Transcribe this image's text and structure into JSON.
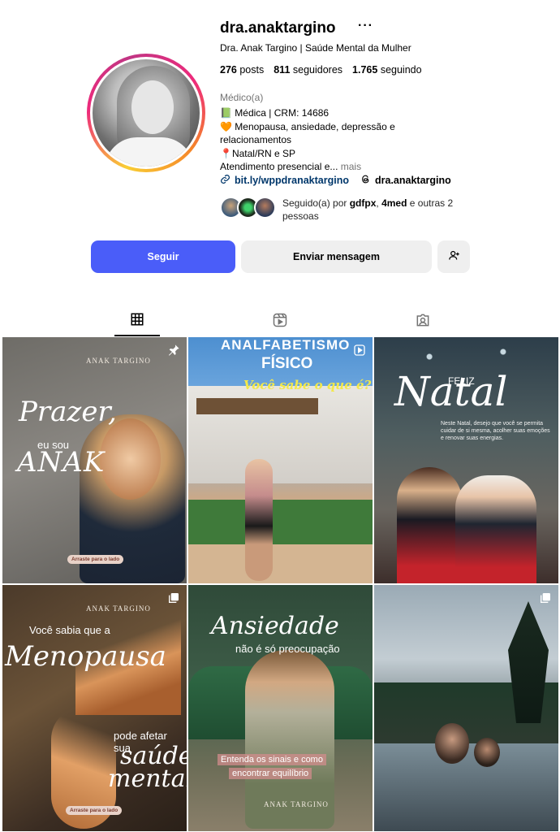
{
  "profile": {
    "username": "dra.anaktargino",
    "more_label": "···",
    "full_name": "Dra. Anak Targino | Saúde Mental da Mulher",
    "stats": {
      "posts_count": "276",
      "posts_label": "posts",
      "followers_count": "811",
      "followers_label": "seguidores",
      "following_count": "1.765",
      "following_label": "seguindo"
    },
    "category": "Médico(a)",
    "bio": {
      "line1": "📗 Médica | CRM: 14686",
      "line2": "🧡 Menopausa, ansiedade, depressão e relacionamentos",
      "line3": "📍Natal/RN e SP",
      "line4": "Atendimento presencial e...",
      "more": " mais"
    },
    "link": "bit.ly/wppdranaktargino",
    "threads": "dra.anaktargino",
    "followed_by": {
      "prefix": "Seguido(a) por ",
      "user1": "gdfpx",
      "sep": ", ",
      "user2": "4med",
      "suffix": " e outras 2 pessoas"
    }
  },
  "actions": {
    "follow": "Seguir",
    "message": "Enviar mensagem"
  },
  "icons": {
    "more": "more-dots-icon",
    "link": "link-icon",
    "threads": "threads-icon",
    "add_person": "add-person-icon",
    "grid": "grid-icon",
    "reels": "reels-icon",
    "tagged": "tagged-icon",
    "pin": "pin-icon",
    "reel": "reel-icon",
    "carousel": "carousel-icon"
  },
  "colors": {
    "follow_button": "#4a5df9",
    "secondary_button": "#efefef",
    "link": "#00376b"
  },
  "posts": [
    {
      "logo": "ANAK TARGINO",
      "line1": "Prazer,",
      "line2": "eu sou",
      "line3": "ANAK",
      "swipe": "Arraste para o lado"
    },
    {
      "line1": "ANALFABETISMO",
      "line2": "FÍSICO",
      "line3": "Você sabe o que é?"
    },
    {
      "line1": "FELIZ",
      "line2": "Natal",
      "body": "Neste Natal, desejo que você se permita cuidar de si mesma, acolher suas emoções e renovar suas energias."
    },
    {
      "logo": "ANAK TARGINO",
      "line1": "Você sabia que a",
      "line2": "Menopausa",
      "line3": "pode afetar sua",
      "line4": "saúde",
      "line5": "mental?",
      "swipe": "Arraste para o lado"
    },
    {
      "line1": "Ansiedade",
      "line2": "não é só preocupação",
      "caption1": "Entenda os sinais e como",
      "caption2": "encontrar equilíbrio",
      "logo": "ANAK TARGINO"
    },
    {}
  ]
}
